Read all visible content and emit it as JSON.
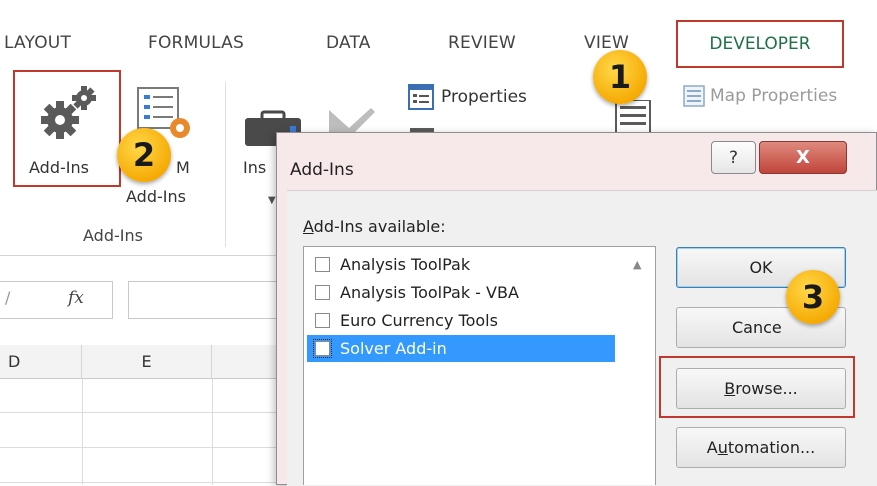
{
  "ribbon": {
    "tabs": {
      "page_layout": "LAYOUT",
      "formulas": "FORMULAS",
      "data": "DATA",
      "review": "REVIEW",
      "view": "VIEW",
      "developer": "DEVELOPER"
    },
    "addins_button": "Add-Ins",
    "com_addins_partial": "M",
    "com_addins_line2": "Add-Ins",
    "group_label": "Add-Ins",
    "insert_partial": "Ins",
    "properties": "Properties",
    "map_properties": "Map Properties"
  },
  "formula_bar": {
    "fx": "fx"
  },
  "sheet": {
    "columns": [
      "D",
      "E"
    ]
  },
  "dialog": {
    "title": "Add-Ins",
    "help": "?",
    "close": "X",
    "available_label": "Add-Ins available:",
    "items": [
      {
        "label": "Analysis ToolPak",
        "checked": false,
        "selected": false
      },
      {
        "label": "Analysis ToolPak - VBA",
        "checked": false,
        "selected": false
      },
      {
        "label": "Euro Currency Tools",
        "checked": false,
        "selected": false
      },
      {
        "label": "Solver Add-in",
        "checked": false,
        "selected": true
      }
    ],
    "buttons": {
      "ok": "OK",
      "cancel": "Cance",
      "browse": "Browse...",
      "automation": "Automation..."
    }
  },
  "callouts": [
    "1",
    "2",
    "3"
  ],
  "colors": {
    "highlight_border": "#c0392b",
    "developer_tab_text": "#1e7145",
    "selection": "#3399ff",
    "badge": "#f5a800"
  }
}
